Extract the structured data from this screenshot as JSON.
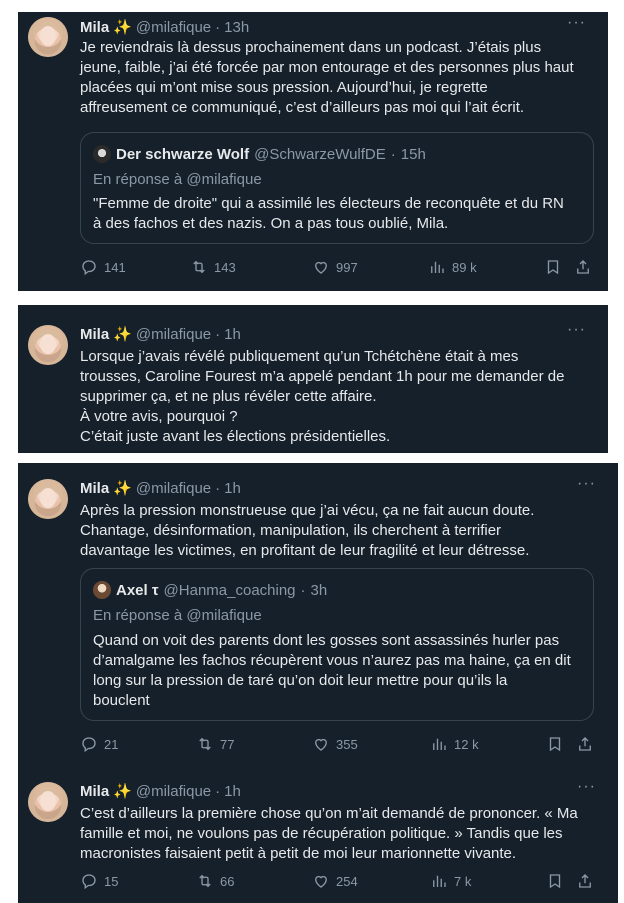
{
  "tweets": [
    {
      "author": "Mila",
      "emoji": "✨",
      "handle": "@milafique",
      "separator": "·",
      "time": "13h",
      "more": "···",
      "lines": [
        "Je reviendrais là dessus prochainement dans un podcast. J’étais plus",
        "jeune, faible, j’ai été forcée par mon entourage et des personnes plus haut",
        "placées qui m’ont mise sous pression. Aujourd’hui, je regrette",
        "affreusement ce communiqué, c’est d’ailleurs pas moi qui l’ait écrit."
      ],
      "quote": {
        "author": "Der schwarze Wolf",
        "handle": "@SchwarzeWulfDE",
        "separator": "·",
        "time": "15h",
        "reply": "En réponse à @milafique",
        "lines": [
          "\"Femme de droite\" qui a assimilé les électeurs de reconquête et du RN",
          "à des fachos et des nazis. On a pas tous oublié, Mila."
        ]
      },
      "stats": {
        "replies": "141",
        "retweets": "143",
        "likes": "997",
        "views": "89 k"
      }
    },
    {
      "author": "Mila",
      "emoji": "✨",
      "handle": "@milafique",
      "separator": "·",
      "time": "1h",
      "more": "···",
      "lines": [
        "Lorsque j’avais révélé publiquement qu’un Tchétchène était à mes",
        "trousses, Caroline Fourest m’a appelé pendant 1h pour me demander de",
        "supprimer ça, et ne plus révéler cette affaire.",
        "À votre avis, pourquoi ?",
        "C’était juste avant les élections présidentielles."
      ]
    },
    {
      "author": "Mila",
      "emoji": "✨",
      "handle": "@milafique",
      "separator": "·",
      "time": "1h",
      "more": "···",
      "lines": [
        "Après la pression monstrueuse que j’ai vécu, ça ne fait aucun doute.",
        "Chantage, désinformation, manipulation, ils cherchent à terrifier",
        "davantage les victimes, en profitant de leur fragilité et leur détresse."
      ],
      "quote": {
        "author": "Axel τ",
        "handle": "@Hanma_coaching",
        "separator": "·",
        "time": "3h",
        "reply": "En réponse à @milafique",
        "lines": [
          "Quand on voit des parents dont les gosses sont assassinés hurler pas",
          "d’amalgame les fachos récupèrent vous n’aurez pas ma haine, ça en dit",
          "long sur la pression de taré qu’on doit leur mettre pour qu’ils la",
          "bouclent"
        ]
      },
      "stats": {
        "replies": "21",
        "retweets": "77",
        "likes": "355",
        "views": "12 k"
      }
    },
    {
      "author": "Mila",
      "emoji": "✨",
      "handle": "@milafique",
      "separator": "·",
      "time": "1h",
      "more": "···",
      "lines": [
        "C’est d’ailleurs la première chose qu’on m’ait demandé de prononcer. « Ma",
        "famille et moi, ne voulons pas de récupération politique. » Tandis que les",
        "macronistes faisaient petit à petit de moi leur marionnette vivante."
      ],
      "stats": {
        "replies": "15",
        "retweets": "66",
        "likes": "254",
        "views": "7 k"
      }
    }
  ],
  "icons": {
    "reply": "reply-icon",
    "retweet": "retweet-icon",
    "like": "like-icon",
    "views": "views-icon",
    "bookmark": "bookmark-icon",
    "share": "share-icon"
  },
  "colors": {
    "background": "#15202b",
    "text": "#e7e9ea",
    "muted": "#8b98a5",
    "border": "#38444d",
    "page": "#ffffff"
  }
}
